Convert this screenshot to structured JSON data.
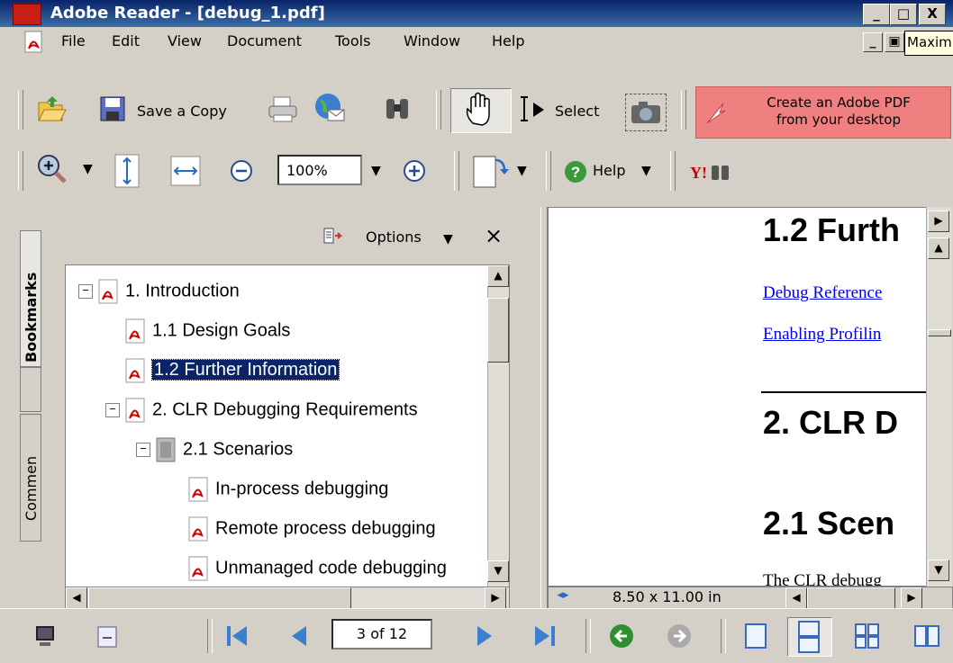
{
  "window": {
    "title": "Adobe Reader - [debug_1.pdf]",
    "buttons": [
      "_",
      "□",
      "X"
    ],
    "tooltip": "Maxim"
  },
  "menu": {
    "items": [
      {
        "label": "File"
      },
      {
        "label": "Edit"
      },
      {
        "label": "View"
      },
      {
        "label": "Document"
      },
      {
        "label": "Tools"
      },
      {
        "label": "Window"
      },
      {
        "label": "Help"
      }
    ]
  },
  "toolbar1": {
    "save_copy": "Save a Copy",
    "select": "Select",
    "banner_line1": "Create an Adobe PDF",
    "banner_line2": "from your desktop"
  },
  "toolbar2": {
    "zoom_value": "100%",
    "help": "Help"
  },
  "bookmarks": {
    "tab_label": "Bookmarks",
    "comments_tab_label": "Commen",
    "options_label": "Options",
    "close": "×",
    "items": [
      {
        "label": "1. Introduction",
        "level": 0,
        "expander": "⊟"
      },
      {
        "label": "1.1 Design Goals",
        "level": 1
      },
      {
        "label": "1.2 Further Information",
        "level": 1,
        "selected": true
      },
      {
        "label": "2. CLR Debugging Requirements",
        "level": 1,
        "expander": "⊟"
      },
      {
        "label": "2.1 Scenarios",
        "level": 2,
        "expander": "⊟"
      },
      {
        "label": "In-process debugging",
        "level": 3
      },
      {
        "label": "Remote process debugging",
        "level": 3
      },
      {
        "label": "Unmanaged code debugging",
        "level": 3
      }
    ]
  },
  "document": {
    "heading1": "1.2  Furth",
    "link1": "Debug Reference",
    "link2": "Enabling Profilin",
    "heading2": "2.  CLR D",
    "heading3": "2.1  Scen",
    "body_text": "The CLR debugg",
    "page_size": "8.50 x 11.00 in"
  },
  "statusbar": {
    "page_indicator": "3 of 12"
  }
}
